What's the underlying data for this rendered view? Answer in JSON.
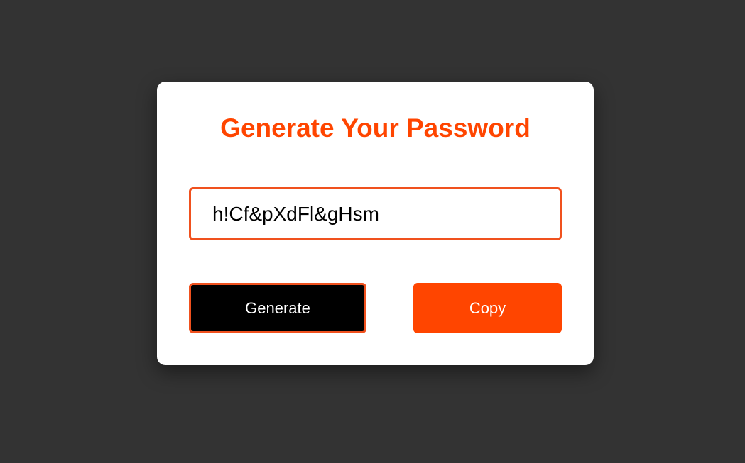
{
  "title": "Generate Your Password",
  "password": {
    "value": "h!Cf&pXdFl&gHsm"
  },
  "buttons": {
    "generate_label": "Generate",
    "copy_label": "Copy"
  },
  "colors": {
    "background": "#333333",
    "card": "#ffffff",
    "accent": "#ff4500",
    "field_border": "#f0511e",
    "generate_button": "#000000"
  }
}
